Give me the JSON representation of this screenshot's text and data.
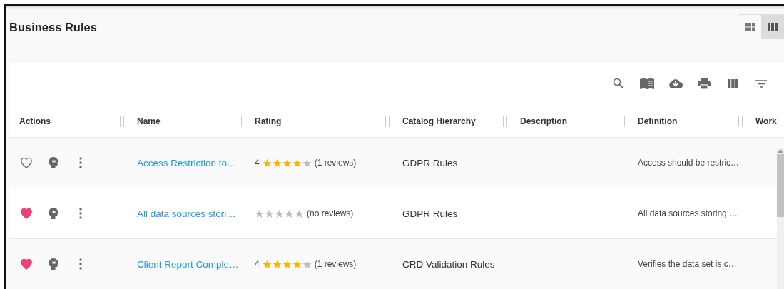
{
  "page": {
    "title": "Business Rules"
  },
  "view_toggle": [
    {
      "kind": "grid",
      "selected": false
    },
    {
      "kind": "columns",
      "selected": true
    }
  ],
  "toolbar": [
    {
      "kind": "search"
    },
    {
      "kind": "book"
    },
    {
      "kind": "download"
    },
    {
      "kind": "print"
    },
    {
      "kind": "columns"
    },
    {
      "kind": "filter"
    }
  ],
  "table": {
    "columns": [
      "Actions",
      "Name",
      "Rating",
      "Catalog Hierarchy",
      "Description",
      "Definition",
      "Work"
    ],
    "rows": [
      {
        "favorite": false,
        "name": "Access Restriction to…",
        "rating": "4",
        "stars": 4,
        "reviews": "(1 reviews)",
        "catalog": "GDPR Rules",
        "definition": "Access should be restric…"
      },
      {
        "favorite": true,
        "name": "All data sources stori…",
        "stars": 0,
        "reviews": "(no reviews)",
        "catalog": "GDPR Rules",
        "definition": "All data sources storing …"
      },
      {
        "favorite": true,
        "name": "Client Report Comple…",
        "rating": "4",
        "stars": 4,
        "reviews": "(1 reviews)",
        "catalog": "CRD Validation Rules",
        "definition": "Verifies the data set is c…"
      }
    ]
  }
}
